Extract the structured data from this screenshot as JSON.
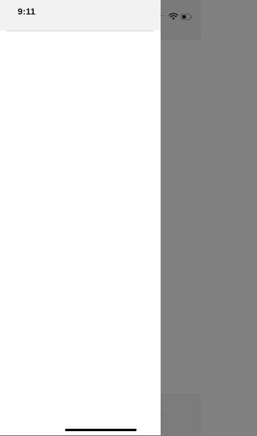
{
  "status_bar": {
    "time": "9:11",
    "signal_dots": "....",
    "icons": [
      "signal-dots-icon",
      "wifi-icon",
      "battery-icon"
    ]
  },
  "drawer": {
    "state": "open",
    "items": []
  },
  "overlay": {
    "color": "#808080"
  },
  "colors": {
    "drawer_background": "#ffffff",
    "drawer_header": "#f2f2f2",
    "scrim": "#808080",
    "home_indicator": "#000000"
  }
}
